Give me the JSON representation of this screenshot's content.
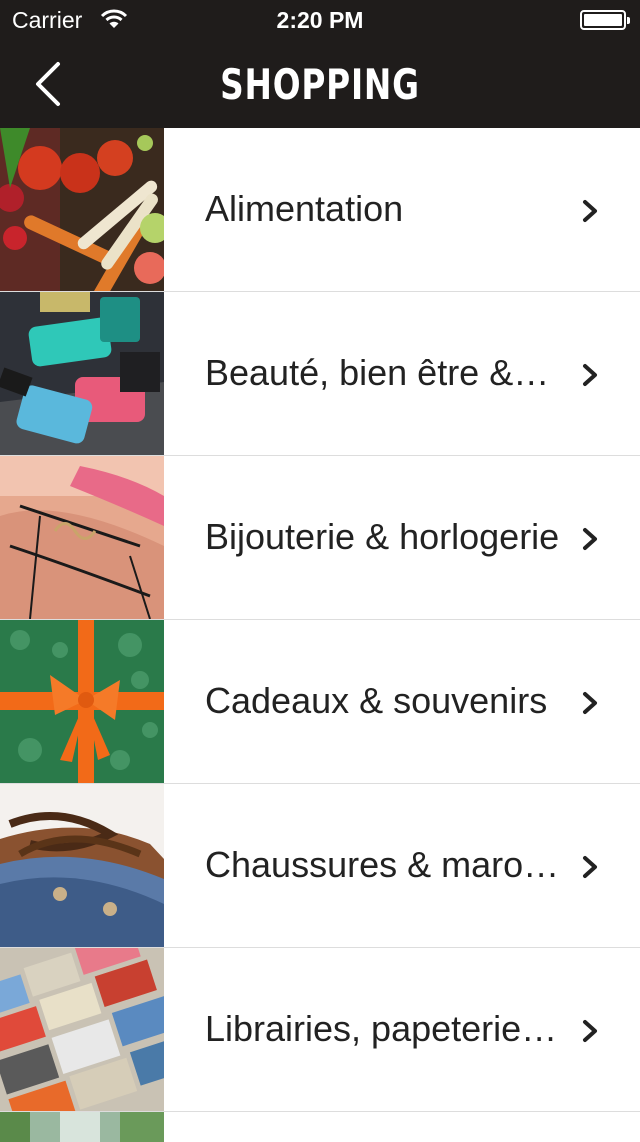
{
  "status_bar": {
    "carrier": "Carrier",
    "time": "2:20 PM"
  },
  "nav": {
    "title": "SHOPPING",
    "back_icon": "chevron-left-icon"
  },
  "categories": [
    {
      "label": "Alimentation",
      "image": "vegetables-photo"
    },
    {
      "label": "Beauté, bien être &…",
      "image": "nail-polish-photo"
    },
    {
      "label": "Bijouterie & horlogerie",
      "image": "bracelet-photo"
    },
    {
      "label": "Cadeaux & souvenirs",
      "image": "gift-ribbon-photo"
    },
    {
      "label": "Chaussures & maro…",
      "image": "shoe-laces-photo"
    },
    {
      "label": "Librairies, papeterie…",
      "image": "books-photo"
    }
  ],
  "colors": {
    "header_bg": "#1f1c1b",
    "row_separator": "#dddddd",
    "text": "#222222"
  }
}
